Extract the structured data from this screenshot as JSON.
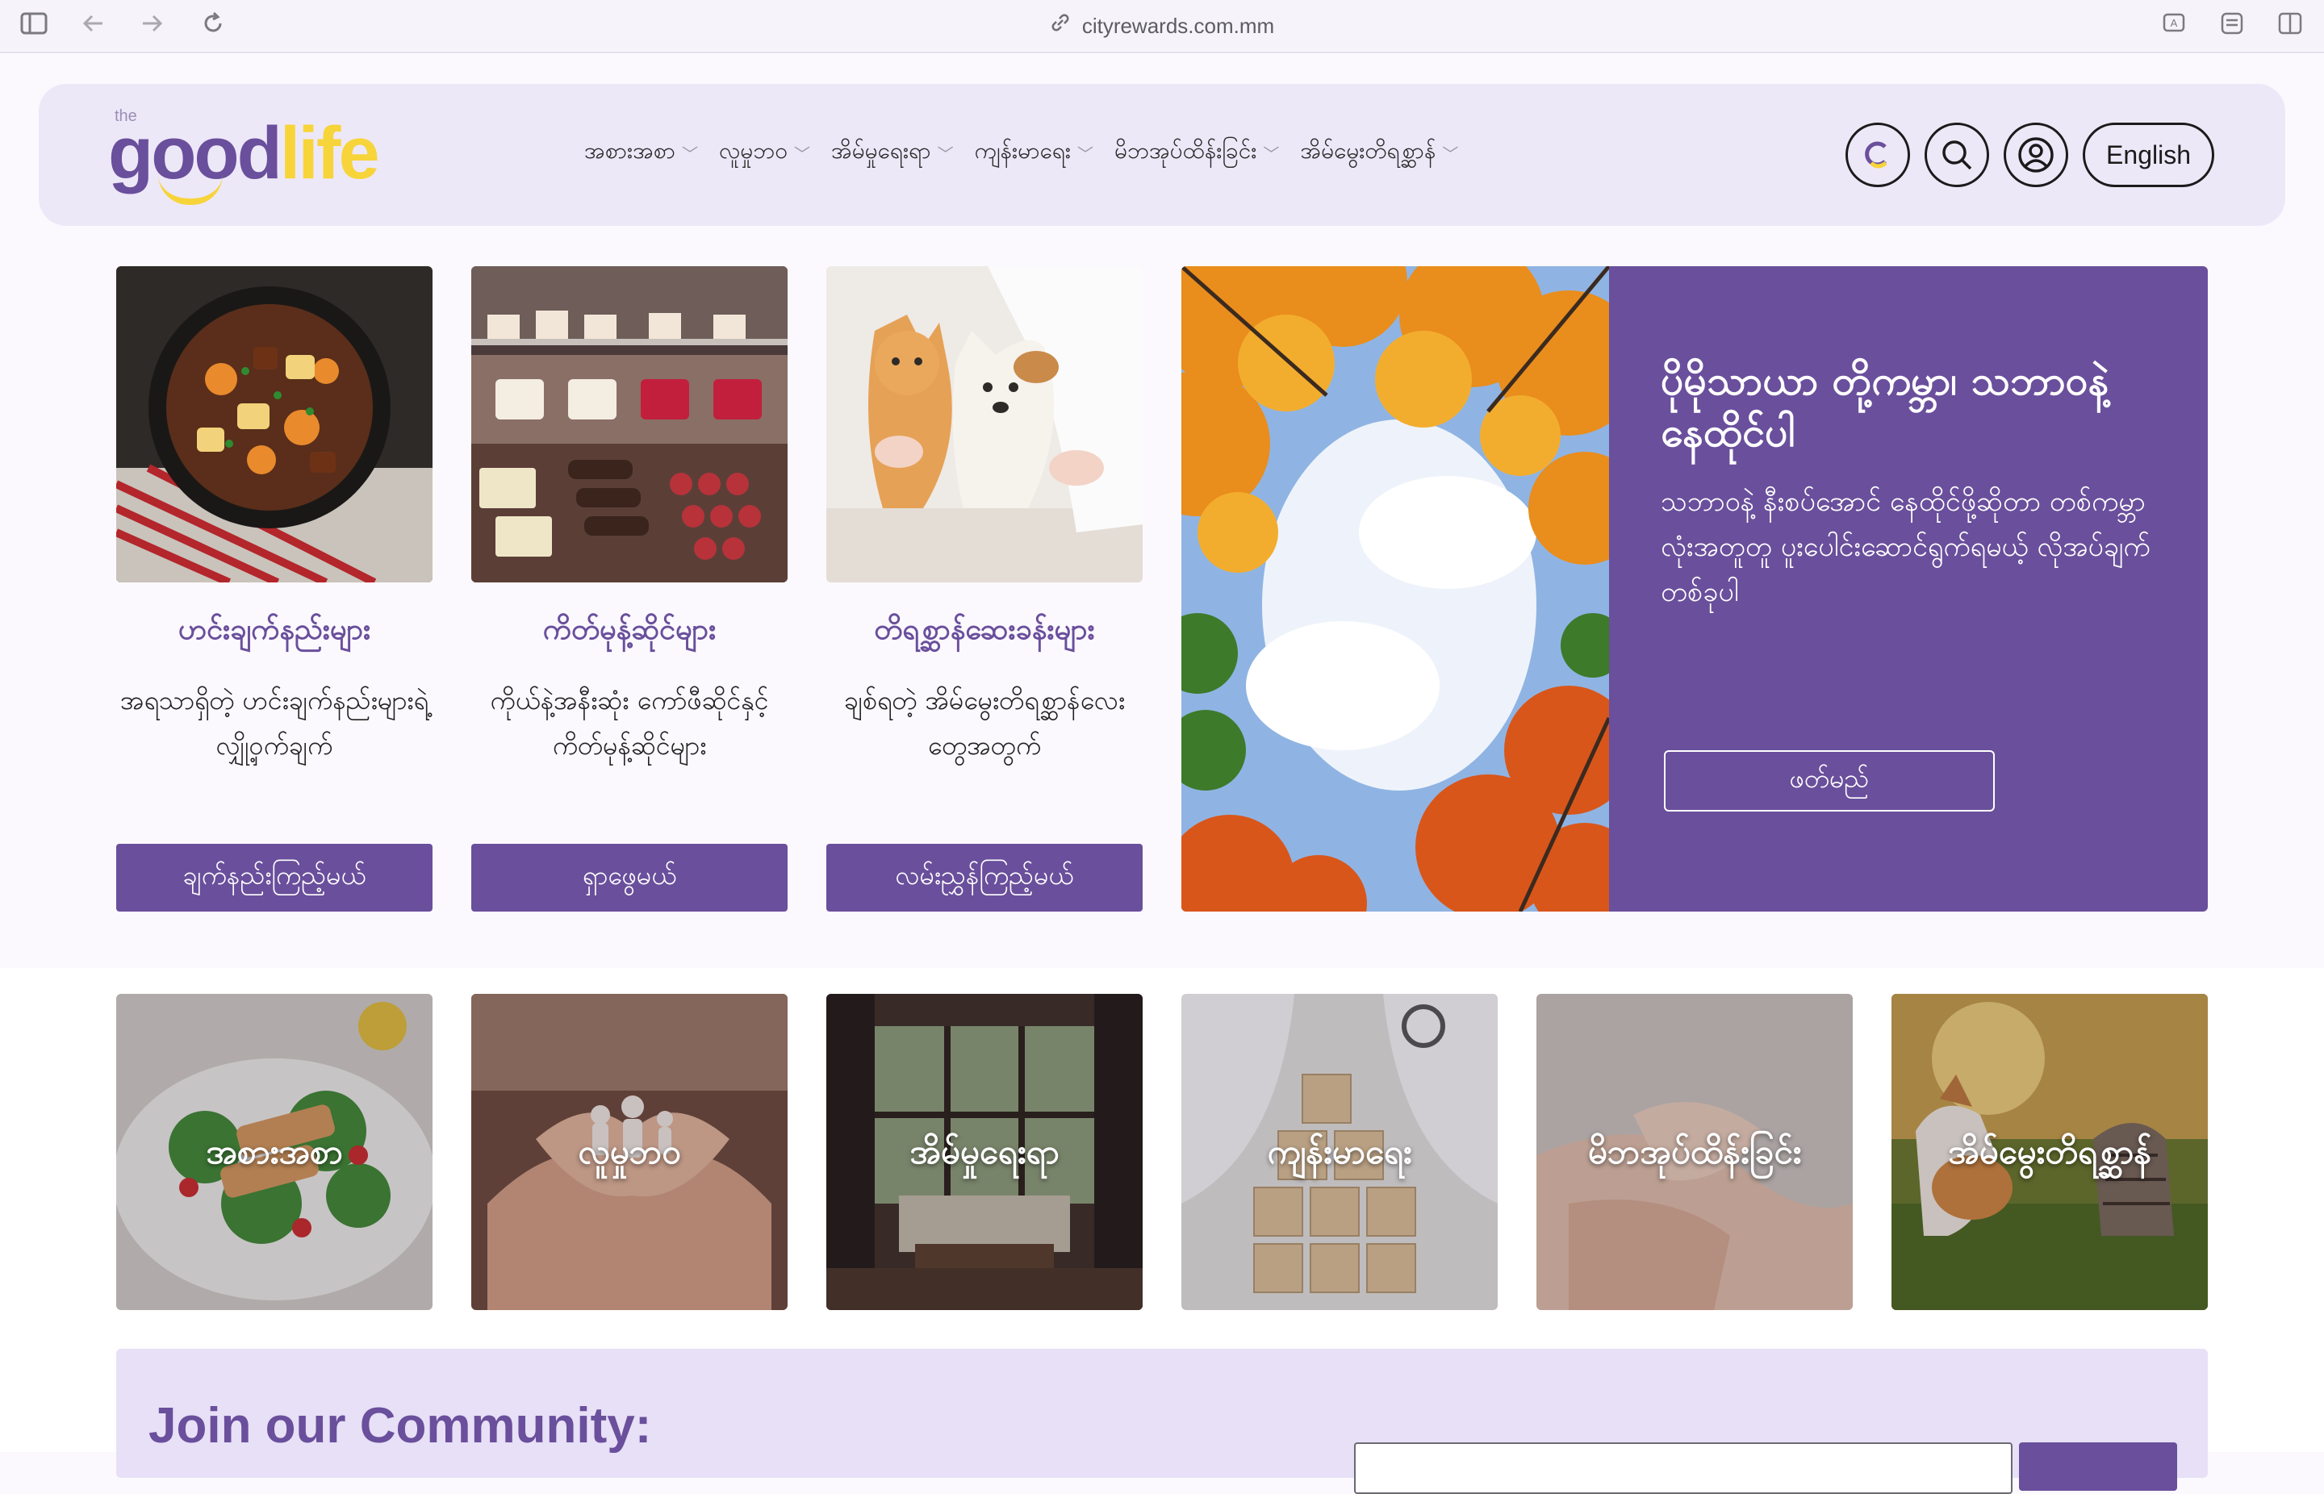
{
  "browser": {
    "url": "cityrewards.com.mm"
  },
  "header": {
    "logo": {
      "the": "the",
      "good": "good",
      "life": "life"
    },
    "menu": [
      "အစားအစာ",
      "လူမှုဘဝ",
      "အိမ်မှုရေးရာ",
      "ကျန်းမာရေး",
      "မိဘအုပ်ထိန်းခြင်း",
      "အိမ်မွေးတိရစ္ဆာန်"
    ],
    "language_label": "English"
  },
  "cards": [
    {
      "title": "ဟင်းချက်နည်းများ",
      "desc": "အရသာရှိတဲ့ ဟင်းချက်နည်းများရဲ့ လျှို့ဝှက်ချက်",
      "button": "ချက်နည်းကြည့်မယ်"
    },
    {
      "title": "ကိတ်မုန့်ဆိုင်များ",
      "desc": "ကိုယ်နဲ့အနီးဆုံး ကော်ဖီဆိုင်နှင့် ကိတ်မုန့်ဆိုင်များ",
      "button": "ရှာဖွေမယ်"
    },
    {
      "title": "တိရစ္ဆာန်ဆေးခန်းများ",
      "desc": "ချစ်ရတဲ့ အိမ်မွေးတိရစ္ဆာန်လေးတွေအတွက်",
      "button": "လမ်းညွှန်ကြည့်မယ်"
    }
  ],
  "promo": {
    "title": "ပိုမိုသာယာ တို့ကမ္ဘာ၊ သဘာဝနဲ့နေထိုင်ပါ",
    "desc": "သဘာဝနဲ့ နီးစပ်အောင် နေထိုင်ဖို့ဆိုတာ တစ်ကမ္ဘာလုံးအတူတူ ပူးပေါင်းဆောင်ရွက်ရမယ့် လိုအပ်ချက်တစ်ခုပါ",
    "button": "ဖတ်မည်"
  },
  "categories": [
    "အစားအစာ",
    "လူမှုဘဝ",
    "အိမ်မှုရေးရာ",
    "ကျန်းမာရေး",
    "မိဘအုပ်ထိန်းခြင်း",
    "အိမ်မွေးတိရစ္ဆာန်"
  ],
  "community": {
    "title": "Join our Community:"
  },
  "colors": {
    "brand_purple": "#6a4f9c",
    "brand_yellow": "#f7d43a",
    "nav_bg": "#ede8f8"
  }
}
